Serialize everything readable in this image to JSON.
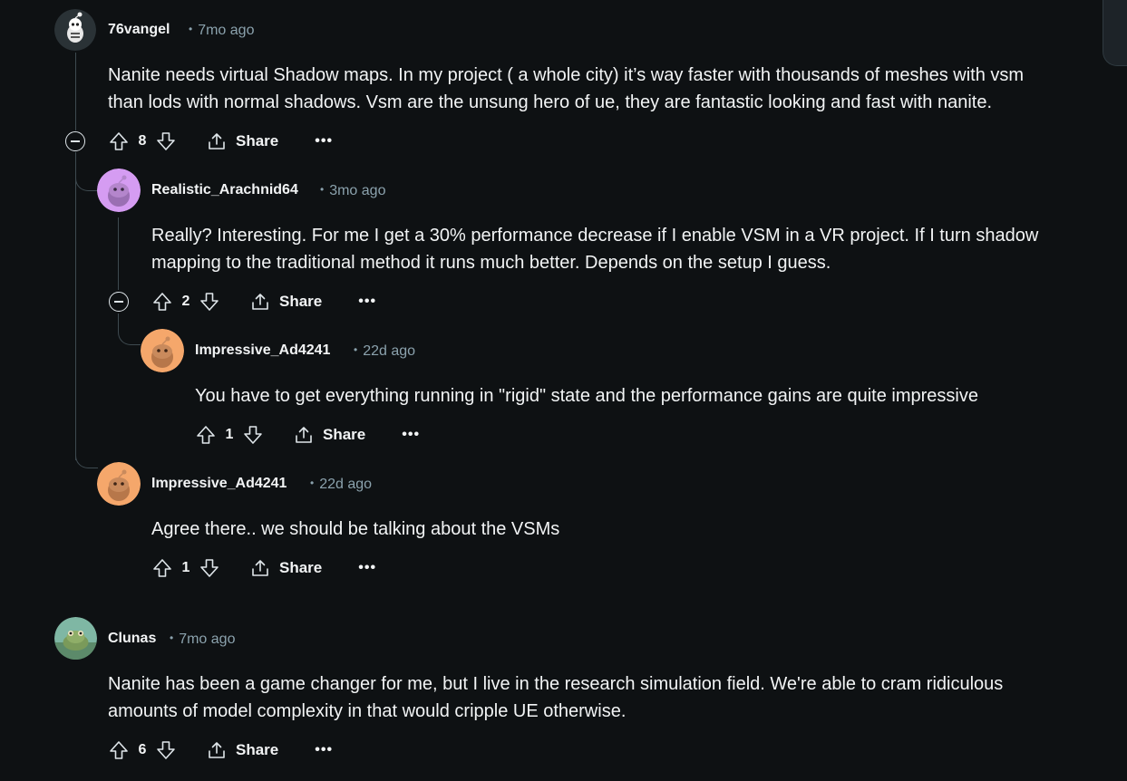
{
  "comments": [
    {
      "username": "76vangel",
      "time": "7mo ago",
      "body_lines": [
        "Nanite needs virtual Shadow maps. In my project ( a whole city) it’s way faster with thousands of meshes with vsm",
        "than lods with normal shadows. Vsm are the unsung hero of ue, they are fantastic looking and fast with nanite."
      ],
      "score": "8",
      "avatar_color": "#2a3236"
    },
    {
      "username": "Realistic_Arachnid64",
      "time": "3mo ago",
      "body_lines": [
        "Really? Interesting. For me I get a 30% performance decrease if I enable VSM in a VR project. If I turn shadow",
        "mapping to the traditional method it runs much better. Depends on the setup I guess."
      ],
      "score": "2",
      "avatar_color": "#d59cf2"
    },
    {
      "username": "Impressive_Ad4241",
      "time": "22d ago",
      "body_lines": [
        "You have to get everything running in \"rigid\" state and the performance gains are quite impressive"
      ],
      "score": "1",
      "avatar_color": "#f5a76b"
    },
    {
      "username": "Impressive_Ad4241",
      "time": "22d ago",
      "body_lines": [
        "Agree there.. we should be talking about the VSMs"
      ],
      "score": "1",
      "avatar_color": "#f5a76b"
    },
    {
      "username": "Clunas",
      "time": "7mo ago",
      "body_lines": [
        "Nanite has been a game changer for me, but I live in the research simulation field. We're able to cram ridiculous",
        "amounts of model complexity in that would cripple UE otherwise."
      ],
      "score": "6",
      "avatar_color": "#7fb7a4"
    }
  ],
  "labels": {
    "share": "Share",
    "more": "•••"
  },
  "icons": {
    "upvote": "arrow-up-outline-icon",
    "downvote": "arrow-down-outline-icon",
    "share": "share-icon",
    "collapse": "minus-circle-icon"
  },
  "colors": {
    "background": "#0e1113",
    "text": "#f2f4f5",
    "meta": "#8ba2ad",
    "thread_line": "#3e4a50"
  }
}
